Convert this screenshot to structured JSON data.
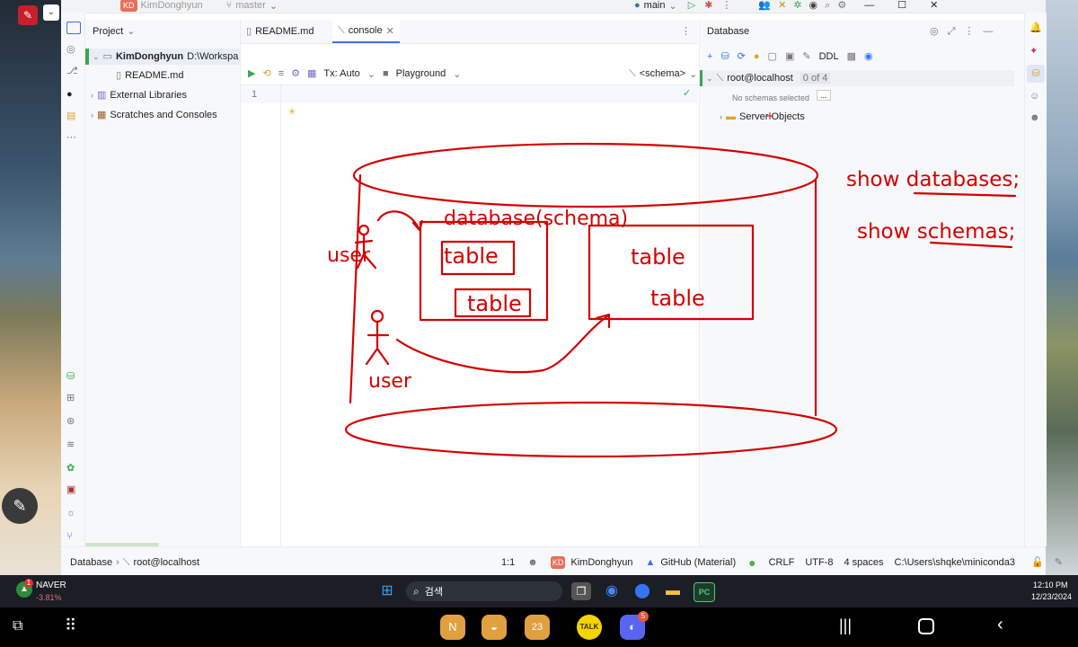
{
  "titlebar": {
    "project_badge": "KD",
    "project_name": "KimDonghyun",
    "branch": "master",
    "run_config": "main"
  },
  "tool_strip_left": {
    "icons": [
      "project-icon",
      "commit-icon",
      "git-icon",
      "github-icon",
      "database-icon",
      "more-icon",
      "services-icon",
      "problems-icon",
      "python-packages-icon",
      "layers-icon",
      "settings-icon",
      "terminal-icon",
      "debug-icon",
      "git-branch-icon"
    ]
  },
  "project_panel": {
    "title": "Project",
    "root_name": "KimDonghyun",
    "root_path": "D:\\Workspa",
    "items": [
      {
        "label": "README.md"
      },
      {
        "label": "External Libraries"
      },
      {
        "label": "Scratches and Consoles"
      }
    ]
  },
  "editor": {
    "tabs": [
      {
        "label": "README.md"
      },
      {
        "label": "console"
      }
    ],
    "toolbar": {
      "tx_mode": "Tx: Auto",
      "playground": "Playground",
      "schema": "<schema>"
    },
    "line_number": "1"
  },
  "database_panel": {
    "title": "Database",
    "ddl_label": "DDL",
    "connection": "root@localhost",
    "schemas_count": "0 of 4",
    "no_schemas": "No schemas selected",
    "more_button": "...",
    "server_objects": "Server Objects"
  },
  "statusbar": {
    "breadcrumb_root": "Database",
    "breadcrumb_item": "root@localhost",
    "position": "1:1",
    "user_badge": "KD",
    "user": "KimDonghyun",
    "theme": "GitHub (Material)",
    "line_sep": "CRLF",
    "encoding": "UTF-8",
    "indent": "4 spaces",
    "interpreter": "C:\\Users\\shqke\\miniconda3"
  },
  "drawing": {
    "color": "#d40000",
    "label_schema": "database(schema)",
    "label_table": "table",
    "label_user": "user",
    "note_1": "show databases;",
    "note_2": "show schemas;"
  },
  "taskbar": {
    "stock_name": "NAVER",
    "stock_change": "-3.81%",
    "notification_count": "1",
    "search_placeholder": "검색",
    "clock_time": "12:10 PM",
    "clock_date": "12/23/2024"
  },
  "dock": {
    "discord_badge": "5",
    "calendar_day": "23",
    "talk_label": "TALK"
  },
  "colors": {
    "accent": "#3574f0",
    "ink": "#d40000",
    "taskbar": "#1b1e25"
  }
}
